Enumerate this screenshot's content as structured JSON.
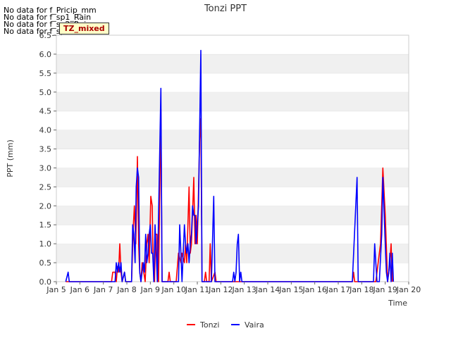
{
  "no_data_messages": [
    "No data for f_Pricip_mm",
    "No data for f_sp1_Rain",
    "No data for f_sp2_Rain",
    "No data for f_sp3_Rain"
  ],
  "badge": "TZ_mixed",
  "colors": {
    "Tonzi": "#ff0000",
    "Vaira": "#0000ff",
    "band": "#f0f0f0",
    "grid": "#dcdcdc"
  },
  "chart_data": {
    "type": "line",
    "title": "Tonzi PPT",
    "xlabel": "Time",
    "ylabel": "PPT (mm)",
    "xlim": [
      0,
      15
    ],
    "ylim": [
      0,
      6.5
    ],
    "x_ticks": [
      "Jan 5",
      "Jan 6",
      "Jan 7",
      "Jan 8",
      "Jan 9",
      "Jan 10",
      "Jan 11",
      "Jan 12",
      "Jan 13",
      "Jan 14",
      "Jan 15",
      "Jan 16",
      "Jan 17",
      "Jan 18",
      "Jan 19",
      "Jan 20"
    ],
    "y_ticks": [
      "0.0",
      "0.5",
      "1.0",
      "1.5",
      "2.0",
      "2.5",
      "3.0",
      "3.5",
      "4.0",
      "4.5",
      "5.0",
      "5.5",
      "6.0",
      "6.5"
    ],
    "legend_position": "bottom-center",
    "series": [
      {
        "name": "Tonzi",
        "points": [
          [
            0.4,
            0
          ],
          [
            2.35,
            0
          ],
          [
            2.4,
            0.25
          ],
          [
            2.5,
            0.25
          ],
          [
            2.55,
            0
          ],
          [
            2.6,
            0.4
          ],
          [
            2.65,
            0.25
          ],
          [
            2.7,
            1.0
          ],
          [
            2.75,
            0.25
          ],
          [
            2.8,
            0
          ],
          [
            2.9,
            0.25
          ],
          [
            2.95,
            0
          ],
          [
            3.2,
            0
          ],
          [
            3.28,
            1.5
          ],
          [
            3.32,
            2.0
          ],
          [
            3.38,
            1.0
          ],
          [
            3.45,
            3.3
          ],
          [
            3.5,
            1.0
          ],
          [
            3.55,
            0.25
          ],
          [
            3.6,
            0
          ],
          [
            3.65,
            0.5
          ],
          [
            3.72,
            0.25
          ],
          [
            3.78,
            0
          ],
          [
            3.85,
            1.0
          ],
          [
            3.9,
            1.25
          ],
          [
            3.95,
            0.5
          ],
          [
            4.02,
            2.25
          ],
          [
            4.08,
            2.0
          ],
          [
            4.12,
            0.5
          ],
          [
            4.18,
            0
          ],
          [
            4.22,
            1.25
          ],
          [
            4.28,
            1.25
          ],
          [
            4.32,
            0
          ],
          [
            4.35,
            0
          ],
          [
            4.45,
            4.55
          ],
          [
            4.5,
            0
          ],
          [
            4.75,
            0
          ],
          [
            4.8,
            0.25
          ],
          [
            4.85,
            0
          ],
          [
            5.1,
            0
          ],
          [
            5.2,
            0.75
          ],
          [
            5.3,
            0.5
          ],
          [
            5.35,
            0.75
          ],
          [
            5.45,
            0.5
          ],
          [
            5.5,
            1.0
          ],
          [
            5.55,
            0.5
          ],
          [
            5.65,
            2.5
          ],
          [
            5.7,
            0.75
          ],
          [
            5.75,
            1.0
          ],
          [
            5.85,
            2.75
          ],
          [
            5.9,
            1.0
          ],
          [
            5.95,
            1.75
          ],
          [
            6.0,
            1.0
          ],
          [
            6.1,
            3.75
          ],
          [
            6.15,
            4.3
          ],
          [
            6.2,
            0
          ],
          [
            6.3,
            0
          ],
          [
            6.35,
            0.25
          ],
          [
            6.4,
            0
          ],
          [
            6.5,
            0
          ],
          [
            6.55,
            1.0
          ],
          [
            6.6,
            0
          ],
          [
            6.75,
            0.25
          ],
          [
            6.8,
            0
          ],
          [
            12.6,
            0
          ],
          [
            12.65,
            0.25
          ],
          [
            12.7,
            0
          ],
          [
            13.6,
            0
          ],
          [
            13.8,
            1.0
          ],
          [
            13.9,
            3.0
          ],
          [
            14.0,
            1.75
          ],
          [
            14.1,
            0
          ],
          [
            14.2,
            0.5
          ],
          [
            14.25,
            1.0
          ],
          [
            14.3,
            0
          ]
        ]
      },
      {
        "name": "Vaira",
        "points": [
          [
            0.4,
            0
          ],
          [
            0.5,
            0.25
          ],
          [
            0.55,
            0
          ],
          [
            2.5,
            0
          ],
          [
            2.55,
            0.5
          ],
          [
            2.6,
            0.25
          ],
          [
            2.65,
            0.5
          ],
          [
            2.7,
            0.25
          ],
          [
            2.75,
            0.5
          ],
          [
            2.8,
            0
          ],
          [
            2.9,
            0.25
          ],
          [
            2.95,
            0
          ],
          [
            3.2,
            0
          ],
          [
            3.25,
            1.5
          ],
          [
            3.3,
            1.25
          ],
          [
            3.35,
            0.5
          ],
          [
            3.4,
            2.5
          ],
          [
            3.45,
            3.0
          ],
          [
            3.5,
            2.75
          ],
          [
            3.55,
            0.25
          ],
          [
            3.6,
            0
          ],
          [
            3.7,
            0.5
          ],
          [
            3.75,
            0.25
          ],
          [
            3.8,
            1.25
          ],
          [
            3.85,
            0.5
          ],
          [
            3.9,
            0.75
          ],
          [
            3.95,
            1.25
          ],
          [
            4.0,
            1.5
          ],
          [
            4.05,
            0.75
          ],
          [
            4.1,
            0.75
          ],
          [
            4.15,
            0
          ],
          [
            4.2,
            1.5
          ],
          [
            4.25,
            0.75
          ],
          [
            4.3,
            0
          ],
          [
            4.45,
            5.1
          ],
          [
            4.5,
            0
          ],
          [
            5.2,
            0
          ],
          [
            5.25,
            1.5
          ],
          [
            5.3,
            0.75
          ],
          [
            5.35,
            0
          ],
          [
            5.4,
            0.75
          ],
          [
            5.45,
            1.5
          ],
          [
            5.5,
            1.0
          ],
          [
            5.55,
            0.75
          ],
          [
            5.6,
            1.0
          ],
          [
            5.65,
            0.5
          ],
          [
            5.7,
            1.0
          ],
          [
            5.75,
            1.25
          ],
          [
            5.8,
            2.0
          ],
          [
            5.85,
            1.75
          ],
          [
            5.9,
            1.75
          ],
          [
            5.95,
            1.0
          ],
          [
            6.05,
            2.0
          ],
          [
            6.1,
            4.0
          ],
          [
            6.15,
            6.1
          ],
          [
            6.2,
            0
          ],
          [
            6.6,
            0
          ],
          [
            6.7,
            2.25
          ],
          [
            6.75,
            0
          ],
          [
            7.5,
            0
          ],
          [
            7.55,
            0.25
          ],
          [
            7.6,
            0
          ],
          [
            7.65,
            0.25
          ],
          [
            7.7,
            1.0
          ],
          [
            7.75,
            1.25
          ],
          [
            7.8,
            0
          ],
          [
            7.85,
            0.25
          ],
          [
            7.9,
            0
          ],
          [
            12.6,
            0
          ],
          [
            12.8,
            2.75
          ],
          [
            12.85,
            0
          ],
          [
            13.5,
            0
          ],
          [
            13.55,
            1.0
          ],
          [
            13.6,
            0.5
          ],
          [
            13.65,
            0
          ],
          [
            13.75,
            0
          ],
          [
            13.85,
            1.25
          ],
          [
            13.9,
            2.75
          ],
          [
            14.0,
            1.0
          ],
          [
            14.05,
            0.25
          ],
          [
            14.1,
            0
          ],
          [
            14.15,
            0.25
          ],
          [
            14.2,
            0.75
          ],
          [
            14.25,
            0
          ],
          [
            14.3,
            0.75
          ],
          [
            14.35,
            0
          ]
        ]
      }
    ]
  }
}
